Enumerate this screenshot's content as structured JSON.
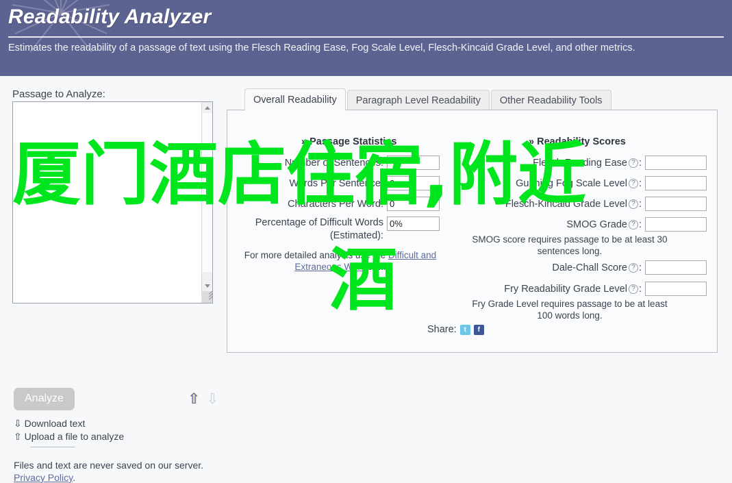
{
  "header": {
    "title": "Readability Analyzer",
    "description": "Estimates the readability of a passage of text using the Flesch Reading Ease, Fog Scale Level, Flesch-Kincaid Grade Level, and other metrics.",
    "background_color": "#5d6391"
  },
  "left": {
    "passage_label": "Passage to Analyze:",
    "textarea_value": "",
    "textarea_placeholder": "",
    "analyze_button": "Analyze",
    "arrow_up_icon": "⇧",
    "arrow_down_icon": "⇩",
    "download_text": "⇩ Download text",
    "upload_text": "⇧ Upload a file to analyze",
    "footnote": "Files and text are never saved on our server.",
    "privacy_link": "Privacy Policy",
    "privacy_suffix": "."
  },
  "tabs": [
    {
      "label": "Overall Readability",
      "active": true
    },
    {
      "label": "Paragraph Level Readability",
      "active": false
    },
    {
      "label": "Other Readability Tools",
      "active": false
    }
  ],
  "passage_statistics": {
    "heading_chevron": "»",
    "heading": "Passage Statistics",
    "rows": [
      {
        "label": "Number of Sentences:",
        "value": ""
      },
      {
        "label": "Words Per Sentence:",
        "value": "0"
      },
      {
        "label": "Characters Per Word:",
        "value": "0"
      },
      {
        "label": "Percentage of Difficult Words (Estimated):",
        "value": "0%"
      }
    ],
    "note_prefix": "For more detailed analysis use the",
    "note_link": "Difficult and Extraneous Word",
    "note_suffix": "tool."
  },
  "readability_scores": {
    "heading_chevron": "»",
    "heading": "Readability Scores",
    "help_icon": "?",
    "rows": [
      {
        "label": "Flesch Reading Ease",
        "value": ""
      },
      {
        "label": "Gunning Fog Scale Level",
        "value": ""
      },
      {
        "label": "Flesch-Kincaid Grade Level",
        "value": ""
      },
      {
        "label": "SMOG Grade",
        "value": ""
      },
      {
        "label": "Dale-Chall Score",
        "value": ""
      },
      {
        "label": "Fry Readability Grade Level",
        "value": ""
      }
    ],
    "smog_note": "SMOG score requires passage to be at least 30 sentences long.",
    "fry_note": "Fry Grade Level requires passage to be at least 100 words long."
  },
  "share": {
    "label": "Share:",
    "twitter_icon": "t",
    "facebook_icon": "f"
  },
  "overlay": {
    "line1": "厦门酒店住宿,附近",
    "line2": "酒",
    "color": "#00e61e"
  }
}
